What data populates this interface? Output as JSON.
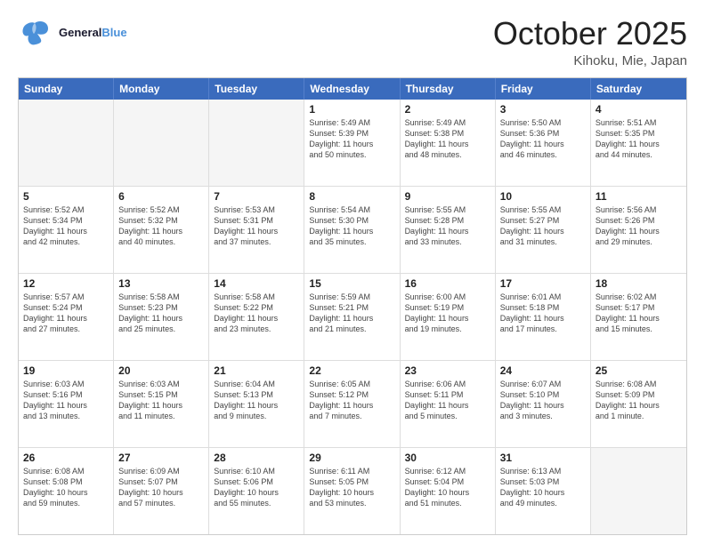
{
  "header": {
    "logo_general": "General",
    "logo_blue": "Blue",
    "month_title": "October 2025",
    "location": "Kihoku, Mie, Japan"
  },
  "weekdays": [
    "Sunday",
    "Monday",
    "Tuesday",
    "Wednesday",
    "Thursday",
    "Friday",
    "Saturday"
  ],
  "rows": [
    [
      {
        "day": "",
        "text": "",
        "empty": true
      },
      {
        "day": "",
        "text": "",
        "empty": true
      },
      {
        "day": "",
        "text": "",
        "empty": true
      },
      {
        "day": "1",
        "text": "Sunrise: 5:49 AM\nSunset: 5:39 PM\nDaylight: 11 hours\nand 50 minutes.",
        "empty": false
      },
      {
        "day": "2",
        "text": "Sunrise: 5:49 AM\nSunset: 5:38 PM\nDaylight: 11 hours\nand 48 minutes.",
        "empty": false
      },
      {
        "day": "3",
        "text": "Sunrise: 5:50 AM\nSunset: 5:36 PM\nDaylight: 11 hours\nand 46 minutes.",
        "empty": false
      },
      {
        "day": "4",
        "text": "Sunrise: 5:51 AM\nSunset: 5:35 PM\nDaylight: 11 hours\nand 44 minutes.",
        "empty": false
      }
    ],
    [
      {
        "day": "5",
        "text": "Sunrise: 5:52 AM\nSunset: 5:34 PM\nDaylight: 11 hours\nand 42 minutes.",
        "empty": false
      },
      {
        "day": "6",
        "text": "Sunrise: 5:52 AM\nSunset: 5:32 PM\nDaylight: 11 hours\nand 40 minutes.",
        "empty": false
      },
      {
        "day": "7",
        "text": "Sunrise: 5:53 AM\nSunset: 5:31 PM\nDaylight: 11 hours\nand 37 minutes.",
        "empty": false
      },
      {
        "day": "8",
        "text": "Sunrise: 5:54 AM\nSunset: 5:30 PM\nDaylight: 11 hours\nand 35 minutes.",
        "empty": false
      },
      {
        "day": "9",
        "text": "Sunrise: 5:55 AM\nSunset: 5:28 PM\nDaylight: 11 hours\nand 33 minutes.",
        "empty": false
      },
      {
        "day": "10",
        "text": "Sunrise: 5:55 AM\nSunset: 5:27 PM\nDaylight: 11 hours\nand 31 minutes.",
        "empty": false
      },
      {
        "day": "11",
        "text": "Sunrise: 5:56 AM\nSunset: 5:26 PM\nDaylight: 11 hours\nand 29 minutes.",
        "empty": false
      }
    ],
    [
      {
        "day": "12",
        "text": "Sunrise: 5:57 AM\nSunset: 5:24 PM\nDaylight: 11 hours\nand 27 minutes.",
        "empty": false
      },
      {
        "day": "13",
        "text": "Sunrise: 5:58 AM\nSunset: 5:23 PM\nDaylight: 11 hours\nand 25 minutes.",
        "empty": false
      },
      {
        "day": "14",
        "text": "Sunrise: 5:58 AM\nSunset: 5:22 PM\nDaylight: 11 hours\nand 23 minutes.",
        "empty": false
      },
      {
        "day": "15",
        "text": "Sunrise: 5:59 AM\nSunset: 5:21 PM\nDaylight: 11 hours\nand 21 minutes.",
        "empty": false
      },
      {
        "day": "16",
        "text": "Sunrise: 6:00 AM\nSunset: 5:19 PM\nDaylight: 11 hours\nand 19 minutes.",
        "empty": false
      },
      {
        "day": "17",
        "text": "Sunrise: 6:01 AM\nSunset: 5:18 PM\nDaylight: 11 hours\nand 17 minutes.",
        "empty": false
      },
      {
        "day": "18",
        "text": "Sunrise: 6:02 AM\nSunset: 5:17 PM\nDaylight: 11 hours\nand 15 minutes.",
        "empty": false
      }
    ],
    [
      {
        "day": "19",
        "text": "Sunrise: 6:03 AM\nSunset: 5:16 PM\nDaylight: 11 hours\nand 13 minutes.",
        "empty": false
      },
      {
        "day": "20",
        "text": "Sunrise: 6:03 AM\nSunset: 5:15 PM\nDaylight: 11 hours\nand 11 minutes.",
        "empty": false
      },
      {
        "day": "21",
        "text": "Sunrise: 6:04 AM\nSunset: 5:13 PM\nDaylight: 11 hours\nand 9 minutes.",
        "empty": false
      },
      {
        "day": "22",
        "text": "Sunrise: 6:05 AM\nSunset: 5:12 PM\nDaylight: 11 hours\nand 7 minutes.",
        "empty": false
      },
      {
        "day": "23",
        "text": "Sunrise: 6:06 AM\nSunset: 5:11 PM\nDaylight: 11 hours\nand 5 minutes.",
        "empty": false
      },
      {
        "day": "24",
        "text": "Sunrise: 6:07 AM\nSunset: 5:10 PM\nDaylight: 11 hours\nand 3 minutes.",
        "empty": false
      },
      {
        "day": "25",
        "text": "Sunrise: 6:08 AM\nSunset: 5:09 PM\nDaylight: 11 hours\nand 1 minute.",
        "empty": false
      }
    ],
    [
      {
        "day": "26",
        "text": "Sunrise: 6:08 AM\nSunset: 5:08 PM\nDaylight: 10 hours\nand 59 minutes.",
        "empty": false
      },
      {
        "day": "27",
        "text": "Sunrise: 6:09 AM\nSunset: 5:07 PM\nDaylight: 10 hours\nand 57 minutes.",
        "empty": false
      },
      {
        "day": "28",
        "text": "Sunrise: 6:10 AM\nSunset: 5:06 PM\nDaylight: 10 hours\nand 55 minutes.",
        "empty": false
      },
      {
        "day": "29",
        "text": "Sunrise: 6:11 AM\nSunset: 5:05 PM\nDaylight: 10 hours\nand 53 minutes.",
        "empty": false
      },
      {
        "day": "30",
        "text": "Sunrise: 6:12 AM\nSunset: 5:04 PM\nDaylight: 10 hours\nand 51 minutes.",
        "empty": false
      },
      {
        "day": "31",
        "text": "Sunrise: 6:13 AM\nSunset: 5:03 PM\nDaylight: 10 hours\nand 49 minutes.",
        "empty": false
      },
      {
        "day": "",
        "text": "",
        "empty": true
      }
    ]
  ]
}
